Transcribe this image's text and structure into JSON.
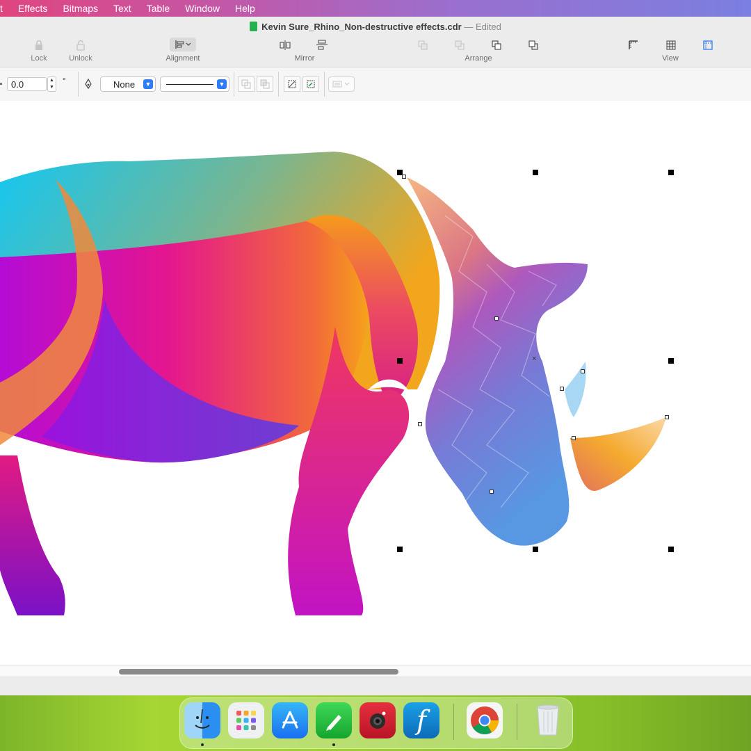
{
  "menubar": {
    "items": [
      "t",
      "Effects",
      "Bitmaps",
      "Text",
      "Table",
      "Window",
      "Help"
    ]
  },
  "window": {
    "title": "Kevin Sure_Rhino_Non-destructive effects.cdr",
    "dash": "—",
    "status": "Edited"
  },
  "toolbar": {
    "lock_label": "Lock",
    "unlock_label": "Unlock",
    "alignment_label": "Alignment",
    "mirror_label": "Mirror",
    "arrange_label": "Arrange",
    "view_label": "View"
  },
  "propbar": {
    "rotation_value": "0.0",
    "degree_symbol": "°",
    "outline_width": "None"
  },
  "canvas": {
    "selection_center_mark": "×"
  },
  "colors": {
    "accent": "#2f7cf6",
    "doc_icon": "#22b14c"
  },
  "dock": {
    "apps": [
      "finder-icon",
      "launchpad-icon",
      "app-store-icon",
      "coreldraw-icon",
      "photo-booth-icon",
      "font-app-icon",
      "chrome-icon",
      "trash-icon"
    ]
  }
}
